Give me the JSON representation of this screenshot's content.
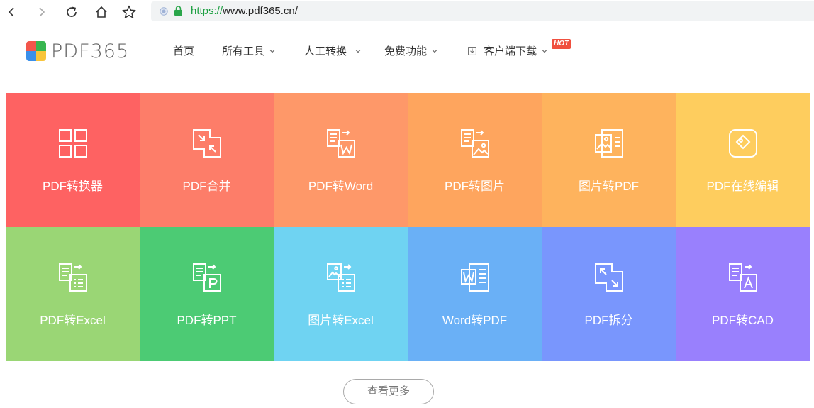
{
  "browser": {
    "url_scheme": "https://",
    "url_rest": "www.pdf365.cn/"
  },
  "logo": {
    "text": "PDF365",
    "colors": [
      "#f2564b",
      "#37b64f",
      "#3a8fea",
      "#f8c43a"
    ]
  },
  "nav": {
    "items": [
      {
        "label": "首页",
        "dropdown": false
      },
      {
        "label": "所有工具",
        "dropdown": true
      },
      {
        "label": "人工转换",
        "dropdown": true
      },
      {
        "label": "免费功能",
        "dropdown": true
      },
      {
        "label": "客户端下载",
        "dropdown": true
      }
    ],
    "hot_badge": "HOT"
  },
  "tiles": [
    {
      "label": "PDF转换器",
      "color": "#fe6262",
      "icon": "grid-icon"
    },
    {
      "label": "PDF合并",
      "color": "#fd7d69",
      "icon": "merge-icon"
    },
    {
      "label": "PDF转Word",
      "color": "#fe9869",
      "icon": "pdf-to-word-icon"
    },
    {
      "label": "PDF转图片",
      "color": "#fea55e",
      "icon": "pdf-to-image-icon"
    },
    {
      "label": "图片转PDF",
      "color": "#feb35d",
      "icon": "image-to-pdf-icon"
    },
    {
      "label": "PDF在线编辑",
      "color": "#fecd5e",
      "icon": "edit-icon"
    },
    {
      "label": "PDF转Excel",
      "color": "#9ad675",
      "icon": "pdf-to-excel-icon"
    },
    {
      "label": "PDF转PPT",
      "color": "#4ccb74",
      "icon": "pdf-to-ppt-icon"
    },
    {
      "label": "图片转Excel",
      "color": "#6fd3f2",
      "icon": "image-to-excel-icon"
    },
    {
      "label": "Word转PDF",
      "color": "#6ab0f6",
      "icon": "word-to-pdf-icon"
    },
    {
      "label": "PDF拆分",
      "color": "#7996fd",
      "icon": "split-icon"
    },
    {
      "label": "PDF转CAD",
      "color": "#9980fd",
      "icon": "pdf-to-cad-icon"
    }
  ],
  "more_button": "查看更多"
}
